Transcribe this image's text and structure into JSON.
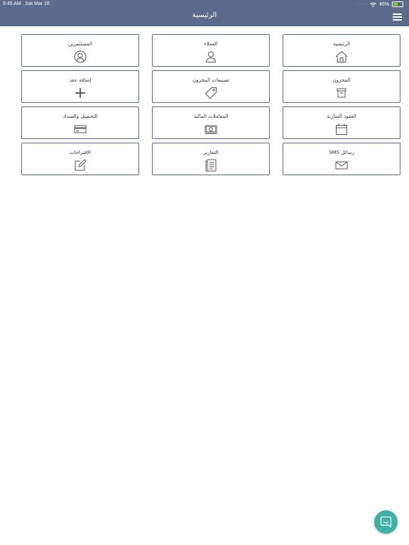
{
  "status_bar": {
    "time": "9:45 AM",
    "date": "Sat Mar 16",
    "battery": "46%",
    "battery_level": 0.46
  },
  "header": {
    "title": "الرئيسية",
    "menu_icon": "hamburger-menu-icon",
    "background": "#5c6a8b"
  },
  "tiles": [
    {
      "label": "الرئيسية",
      "icon": "home-icon"
    },
    {
      "label": "العملاء",
      "icon": "customer-icon"
    },
    {
      "label": "المستثمرين",
      "icon": "investor-icon"
    },
    {
      "label": "المخزون",
      "icon": "inventory-box-icon"
    },
    {
      "label": "تصنيفات المخزون",
      "icon": "tag-icon"
    },
    {
      "label": "إضافة عقد",
      "icon": "plus-icon"
    },
    {
      "label": "العقود السارية",
      "icon": "calendar-icon"
    },
    {
      "label": "المعاملات المالية",
      "icon": "money-icon"
    },
    {
      "label": "التحصيل والسداد",
      "icon": "credit-card-icon"
    },
    {
      "label": "رسائل SMS",
      "icon": "envelope-icon"
    },
    {
      "label": "التقارير",
      "icon": "report-icon"
    },
    {
      "label": "الاقتراحات",
      "icon": "edit-icon"
    }
  ],
  "chat": {
    "icon": "chat-icon",
    "color": "#3fb2a8"
  }
}
